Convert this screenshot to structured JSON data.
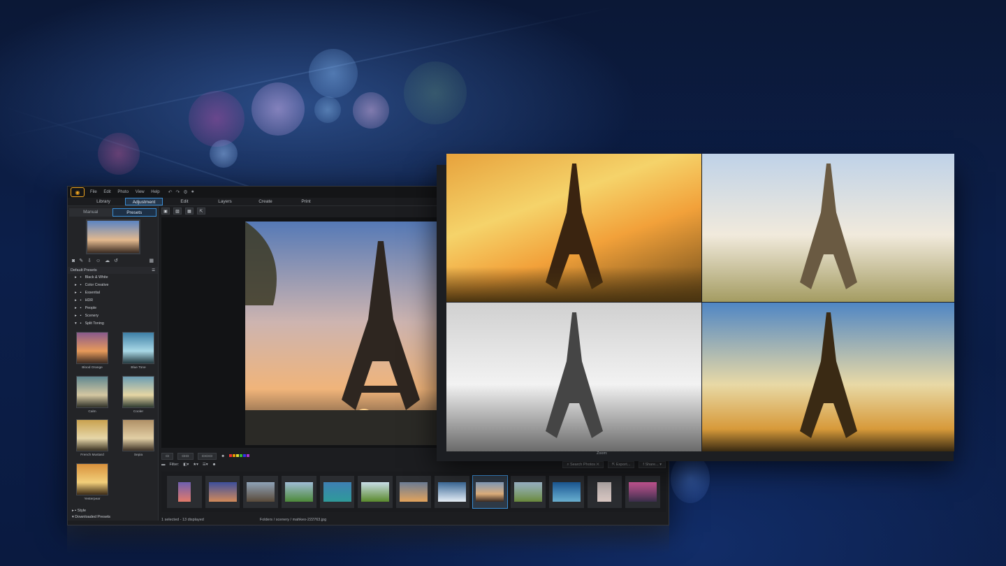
{
  "app": {
    "menu": [
      "File",
      "Edit",
      "Photo",
      "View",
      "Help"
    ],
    "modes": [
      {
        "label": "Library",
        "active": false
      },
      {
        "label": "Adjustment",
        "active": true
      },
      {
        "label": "Edit",
        "active": false
      },
      {
        "label": "Layers",
        "active": false
      },
      {
        "label": "Create",
        "active": false
      },
      {
        "label": "Print",
        "active": false
      }
    ],
    "left_tabs": [
      {
        "label": "Manual",
        "active": false
      },
      {
        "label": "Presets",
        "active": true
      }
    ],
    "section_default": "Default Presets",
    "tree": [
      "Black & White",
      "Color Creative",
      "Essential",
      "HDR",
      "People",
      "Scenery",
      "Split Toning"
    ],
    "presets": [
      "Blood Orange",
      "Blue Tone",
      "Calm",
      "Cooler",
      "French Mustard",
      "Sepia",
      "Yesterpear"
    ],
    "bottom_items": [
      "Style",
      "Downloaded Presets"
    ],
    "filter_label": "Filter:",
    "search_label": "Search Photos",
    "export_label": "Export...",
    "share_label": "Share...",
    "status_selection": "1 selected - 13 displayed",
    "status_path": "Folders / scenery / mahkeo-222763.jpg",
    "zoom_label": "Zoom:"
  },
  "colors": {
    "accent": "#3a8fd7",
    "brand": "#f0a521",
    "background": "#0c1f4a"
  }
}
